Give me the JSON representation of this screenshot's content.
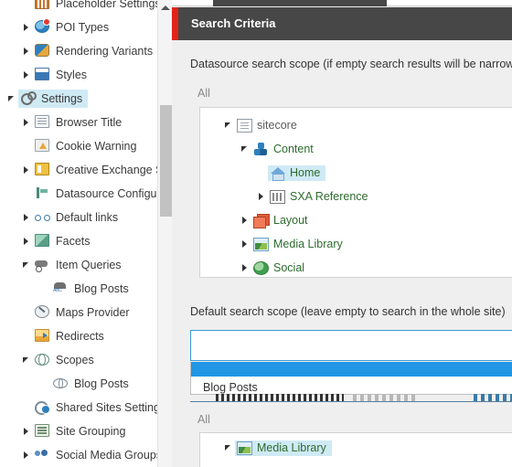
{
  "sidebar": {
    "items": [
      {
        "label": "Placeholder Settings",
        "icon": "grid-icon",
        "arrow": "none",
        "indent": 20,
        "selected": false,
        "clipped_top": true
      },
      {
        "label": "POI Types",
        "icon": "globe-badge-icon",
        "arrow": "collapsed",
        "indent": 20,
        "selected": false
      },
      {
        "label": "Rendering Variants",
        "icon": "masks-icon",
        "arrow": "collapsed",
        "indent": 20,
        "selected": false
      },
      {
        "label": "Styles",
        "icon": "styles-icon",
        "arrow": "collapsed",
        "indent": 20,
        "selected": false
      },
      {
        "label": "Settings",
        "icon": "gear-icon",
        "arrow": "expanded",
        "indent": 4,
        "selected": true
      },
      {
        "label": "Browser Title",
        "icon": "document-icon",
        "arrow": "collapsed",
        "indent": 20,
        "selected": false
      },
      {
        "label": "Cookie Warning",
        "icon": "warning-icon",
        "arrow": "none",
        "indent": 20,
        "selected": false
      },
      {
        "label": "Creative Exchange Sto",
        "icon": "stack-icon",
        "arrow": "collapsed",
        "indent": 20,
        "selected": false
      },
      {
        "label": "Datasource Configura",
        "icon": "datasource-config-icon",
        "arrow": "none",
        "indent": 20,
        "selected": false
      },
      {
        "label": "Default links",
        "icon": "links-icon",
        "arrow": "collapsed",
        "indent": 20,
        "selected": false
      },
      {
        "label": "Facets",
        "icon": "facets-icon",
        "arrow": "collapsed",
        "indent": 20,
        "selected": false
      },
      {
        "label": "Item Queries",
        "icon": "item-queries-icon",
        "arrow": "expanded",
        "indent": 20,
        "selected": false
      },
      {
        "label": "Blog Posts",
        "icon": "abc-icon",
        "arrow": "none",
        "indent": 40,
        "selected": false
      },
      {
        "label": "Maps Provider",
        "icon": "maps-provider-icon",
        "arrow": "none",
        "indent": 20,
        "selected": false
      },
      {
        "label": "Redirects",
        "icon": "redirects-icon",
        "arrow": "none",
        "indent": 20,
        "selected": false
      },
      {
        "label": "Scopes",
        "icon": "scopes-icon",
        "arrow": "expanded",
        "indent": 20,
        "selected": false
      },
      {
        "label": "Blog Posts",
        "icon": "scope-item-icon",
        "arrow": "none",
        "indent": 40,
        "selected": false
      },
      {
        "label": "Shared Sites Settings",
        "icon": "shared-settings-icon",
        "arrow": "none",
        "indent": 20,
        "selected": false
      },
      {
        "label": "Site Grouping",
        "icon": "site-grouping-icon",
        "arrow": "collapsed",
        "indent": 20,
        "selected": false
      },
      {
        "label": "Social Media Groups",
        "icon": "social-media-icon",
        "arrow": "collapsed",
        "indent": 20,
        "selected": false
      }
    ],
    "scrollbar": {
      "up_arrow_icon": "scroll-up-arrow-icon"
    }
  },
  "panel": {
    "title": "Search Criteria",
    "accent_color": "#e2231a",
    "header_bg": "#474747"
  },
  "datasource_scope": {
    "label": "Datasource search scope (if empty search results will be narrow",
    "all_label": "All",
    "tree": [
      {
        "label": "sitecore",
        "icon": "sitecore-icon",
        "arrow": "expanded",
        "indent": 22,
        "selected": false,
        "root": true
      },
      {
        "label": "Content",
        "icon": "content-icon",
        "arrow": "expanded",
        "indent": 40,
        "selected": false
      },
      {
        "label": "Home",
        "icon": "home-icon",
        "arrow": "none",
        "indent": 58,
        "selected": true
      },
      {
        "label": "SXA Reference",
        "icon": "sxa-reference-icon",
        "arrow": "collapsed",
        "indent": 58,
        "selected": false
      },
      {
        "label": "Layout",
        "icon": "layout-icon",
        "arrow": "collapsed",
        "indent": 40,
        "selected": false
      },
      {
        "label": "Media Library",
        "icon": "media-library-icon",
        "arrow": "collapsed",
        "indent": 40,
        "selected": false
      },
      {
        "label": "Social",
        "icon": "social-icon",
        "arrow": "collapsed",
        "indent": 40,
        "selected": false
      }
    ]
  },
  "default_scope": {
    "label": "Default search scope (leave empty to search in the whole site)",
    "selected_value": "",
    "options": [
      {
        "label": "",
        "highlighted": true
      },
      {
        "label": "Blog Posts",
        "highlighted": false
      }
    ]
  },
  "associated_media": {
    "all_label": "All",
    "tree": [
      {
        "label": "Media Library",
        "icon": "media-library-icon",
        "arrow": "expanded",
        "indent": 22,
        "selected": true
      }
    ]
  }
}
